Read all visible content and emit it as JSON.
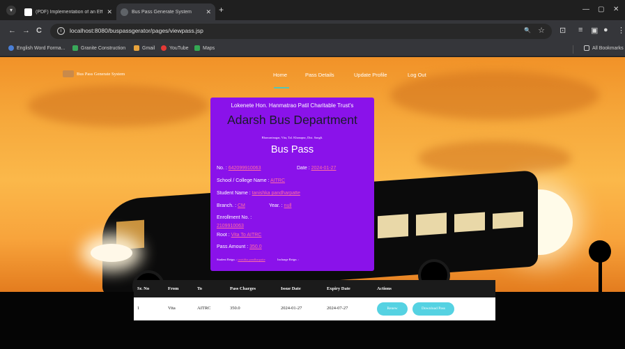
{
  "browser": {
    "tabs": [
      {
        "title": "(PDF) Implementation of an Eff",
        "favicon_color": "#ffffff"
      },
      {
        "title": "Bus Pass Generate System",
        "favicon_color": "#5f6368"
      }
    ],
    "tab_close": "✕",
    "new_tab": "+",
    "window_controls": {
      "minimize": "—",
      "maximize": "▢",
      "close": "✕"
    },
    "nav": {
      "back": "←",
      "forward": "→",
      "reload": "C"
    },
    "url": "localhost:8080/buspassgerator/pages/viewpass.jsp",
    "icons": {
      "info": "i",
      "zoom": "🔍",
      "star": "☆",
      "ext1": "⊡",
      "ext2": "≡",
      "ext3": "▣",
      "profile": "●",
      "menu": "⋮"
    },
    "bookmarks": [
      {
        "label": "English Word Forma...",
        "color": "#4a7fd6"
      },
      {
        "label": "Granite Construction",
        "color": "#39a85a"
      },
      {
        "label": "Gmail",
        "color": "#e8a33c"
      },
      {
        "label": "YouTube",
        "color": "#e53935"
      },
      {
        "label": "Maps",
        "color": "#34a853"
      }
    ],
    "all_bookmarks": "All Bookmarks"
  },
  "site": {
    "logo_text": "Bus Pass Generate System",
    "nav": [
      "Home",
      "Pass Details",
      "Update Profile",
      "Log Out"
    ],
    "accent": "#55c6b6"
  },
  "pass": {
    "trust": "Lokenete Hon. Hanmatrao Patil Charitable Trust's",
    "department": "Adarsh Bus Department",
    "address": "Bhawaninagar, Vita, Tal. Khanapur, Dist. Sangli.",
    "title": "Bus Pass",
    "no_label": "No. :",
    "no_value": "642099910063",
    "date_label": "Date :",
    "date_value": "2024-01-27",
    "school_label": "School / College Name :",
    "school_value": "AITRC",
    "student_label": "Student Name :",
    "student_value": "tanishka pandharpatte",
    "branch_label": "Branch. :",
    "branch_value": "CM",
    "year_label": "Year. :",
    "year_value": "null",
    "enrollment_label": "Enrollment No. :",
    "enrollment_value": "2109910063",
    "root_label": "Root :",
    "root_value": "Vita To AITRC",
    "amount_label": "Pass Amount :",
    "amount_value": "350.0",
    "student_sign_label": "Student Reign. :",
    "student_sign_value": "tanishka pandharpatte",
    "incharge_sign_label": "Incharge Reign. :",
    "bg_color": "#8a12ea",
    "link_color": "#ff6fa2"
  },
  "table": {
    "headers": [
      "Sr. No",
      "From",
      "To",
      "Pass Charges",
      "Issue Date",
      "Expiry Date",
      "Actions"
    ],
    "rows": [
      {
        "sr": "1",
        "from": "Vita",
        "to": "AITRC",
        "charges": "350.0",
        "issue": "2024-01-27",
        "expiry": "2024-07-27",
        "renew": "Renew",
        "download": "Download Pass"
      }
    ]
  }
}
